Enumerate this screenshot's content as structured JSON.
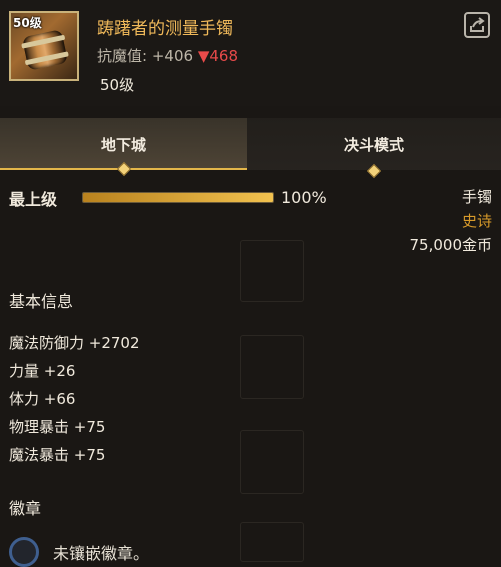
{
  "header": {
    "item_name": "踌躇者的测量手镯",
    "icon_level": "50级",
    "resist_label": "抗魔值:",
    "resist_value": "+406",
    "resist_down": "▼468",
    "level": "50级",
    "share_icon": "share-export-icon"
  },
  "tabs": [
    {
      "label": "地下城",
      "active": true
    },
    {
      "label": "决斗模式",
      "active": false
    }
  ],
  "grade": {
    "label": "最上级",
    "percent_text": "100%",
    "progress": 1.0
  },
  "item_info": {
    "type": "手镯",
    "rarity": "史诗",
    "price": "75,000金币"
  },
  "basic_info": {
    "title": "基本信息",
    "stats": [
      "魔法防御力 +2702",
      "力量 +26",
      "体力 +66",
      "物理暴击 +75",
      "魔法暴击 +75"
    ]
  },
  "emblem": {
    "title": "徽章",
    "empty_text": "未镶嵌徽章。"
  },
  "colors": {
    "item_name": "#f0b95a",
    "rarity": "#d89b2a",
    "down_arrow": "#e84a4a",
    "tab_underline": "#e3b64a"
  }
}
